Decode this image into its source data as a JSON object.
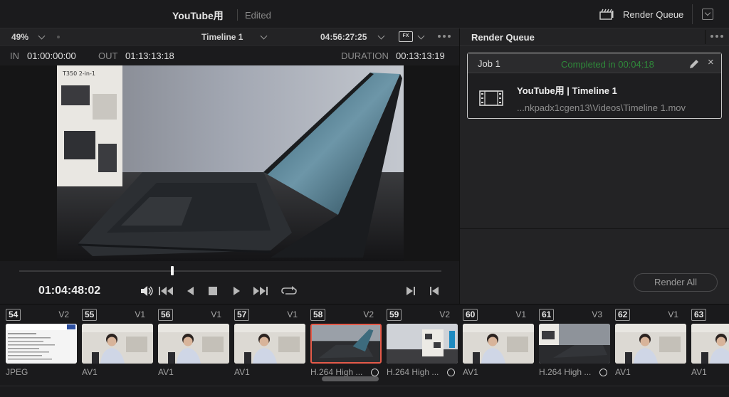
{
  "app": {
    "project_title": "YouTube用",
    "status": "Edited",
    "render_queue_label": "Render Queue"
  },
  "viewer": {
    "zoom": "49%",
    "timeline_name": "Timeline 1",
    "timecode_header": "04:56:27:25",
    "fx_label": "FX",
    "in_label": "IN",
    "in_value": "01:00:00:00",
    "out_label": "OUT",
    "out_value": "01:13:13:18",
    "duration_label": "DURATION",
    "duration_value": "00:13:13:19",
    "current_timecode": "01:04:48:02"
  },
  "render_queue": {
    "title": "Render Queue",
    "job": {
      "name": "Job 1",
      "status": "Completed in 00:04:18",
      "title": "YouTube用 | Timeline 1",
      "path": "...nkpadx1cgen13\\Videos\\Timeline 1.mov"
    },
    "render_all_label": "Render All"
  },
  "clips": [
    {
      "num": "54",
      "track": "V2",
      "codec": "JPEG",
      "kind": "doc"
    },
    {
      "num": "55",
      "track": "V1",
      "codec": "AV1",
      "kind": "person"
    },
    {
      "num": "56",
      "track": "V1",
      "codec": "AV1",
      "kind": "person"
    },
    {
      "num": "57",
      "track": "V1",
      "codec": "AV1",
      "kind": "person"
    },
    {
      "num": "58",
      "track": "V2",
      "codec": "H.264 High ...",
      "kind": "tablet",
      "selected": true
    },
    {
      "num": "59",
      "track": "V2",
      "codec": "H.264 High ...",
      "kind": "box"
    },
    {
      "num": "60",
      "track": "V1",
      "codec": "AV1",
      "kind": "person"
    },
    {
      "num": "61",
      "track": "V3",
      "codec": "H.264 High ...",
      "kind": "tablet2"
    },
    {
      "num": "62",
      "track": "V1",
      "codec": "AV1",
      "kind": "person"
    },
    {
      "num": "63",
      "track": "",
      "codec": "AV1",
      "kind": "person"
    }
  ],
  "colors": {
    "status_green": "#2f8a3a",
    "selected_border": "#e55b4a"
  }
}
